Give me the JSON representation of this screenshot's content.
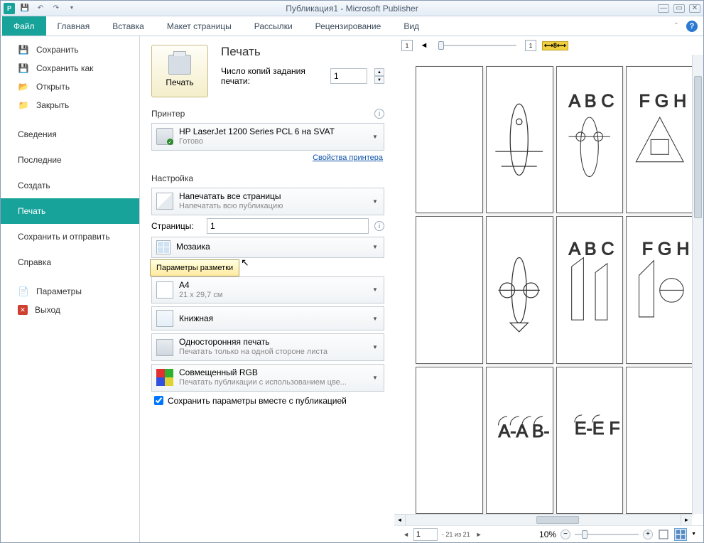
{
  "titlebar": {
    "title": "Публикация1  -  Microsoft Publisher"
  },
  "ribbon": {
    "tabs": [
      "Файл",
      "Главная",
      "Вставка",
      "Макет страницы",
      "Рассылки",
      "Рецензирование",
      "Вид"
    ]
  },
  "leftnav": {
    "save": "Сохранить",
    "saveas": "Сохранить как",
    "open": "Открыть",
    "close": "Закрыть",
    "info": "Сведения",
    "recent": "Последние",
    "new": "Создать",
    "print": "Печать",
    "share": "Сохранить и отправить",
    "help": "Справка",
    "options": "Параметры",
    "exit": "Выход"
  },
  "print": {
    "title": "Печать",
    "button": "Печать",
    "copies_label": "Число копий задания печати:",
    "copies_value": "1",
    "printer_section": "Принтер",
    "printer_name": "HP LaserJet 1200 Series PCL 6 на SVAT",
    "printer_status": "Готово",
    "printer_props": "Свойства принтера",
    "settings_section": "Настройка",
    "print_all": "Напечатать все страницы",
    "print_all_sub": "Напечатать всю публикацию",
    "pages_label": "Страницы:",
    "pages_value": "1",
    "mosaic": "Мозаика",
    "tooltip": "Параметры разметки",
    "a4": "A4",
    "a4_sub": "21 x 29,7 см",
    "orient": "Книжная",
    "oneside": "Односторонняя печать",
    "oneside_sub": "Печатать только на одной стороне листа",
    "rgb": "Совмещенный RGB",
    "rgb_sub": "Печатать публикации с использованием цве...",
    "save_params": "Сохранить параметры вместе с публикацией"
  },
  "preview": {
    "page_input": "1",
    "page_status": "- 21 из 21",
    "zoom": "10%"
  }
}
